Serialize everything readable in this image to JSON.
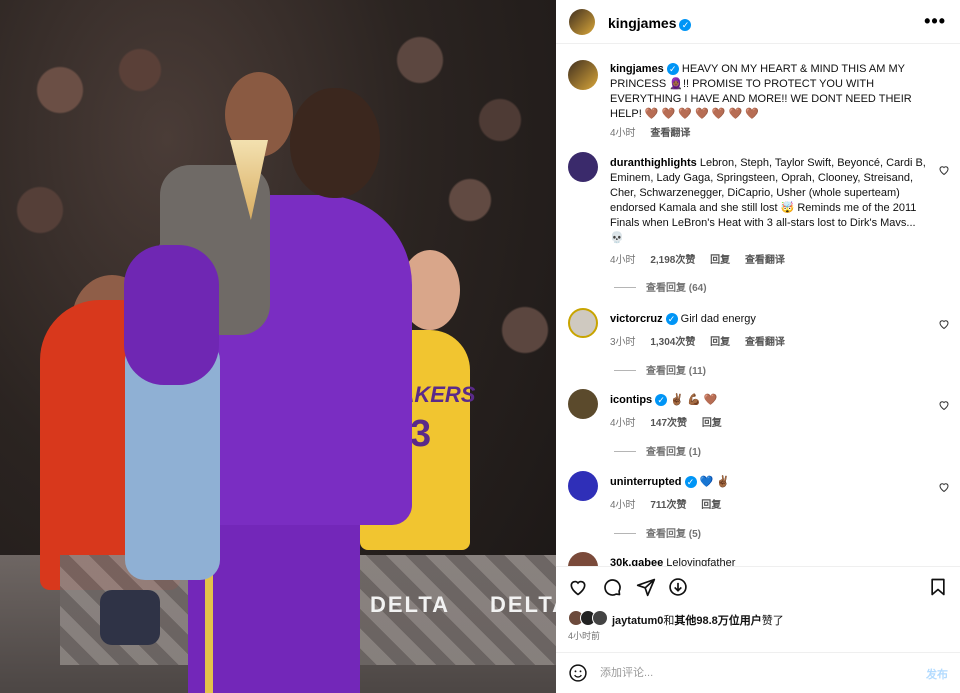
{
  "header": {
    "username": "kingjames",
    "verified_mark": "✓",
    "more": "•••"
  },
  "caption": {
    "username": "kingjames",
    "text": "HEAVY ON MY HEART & MIND THIS AM MY PRINCESS 🧕🏾!! PROMISE TO PROTECT YOU WITH EVERYTHING I HAVE AND MORE!! WE DONT NEED THEIR HELP! 🤎 🤎 🤎 🤎 🤎 🤎 🤎",
    "time": "4小时",
    "translate": "查看翻译"
  },
  "comments": [
    {
      "username": "duranthighlights",
      "text": "Lebron, Steph, Taylor Swift, Beyoncé, Cardi B, Eminem, Lady Gaga, Springsteen, Oprah, Clooney, Streisand, Cher, Schwarzenegger, DiCaprio, Usher (whole superteam) endorsed Kamala and she still lost 🤯 Reminds me of the 2011 Finals when LeBron's Heat with 3 all-stars lost to Dirk's Mavs... 💀",
      "time": "4小时",
      "likes": "2,198次赞",
      "reply": "回复",
      "translate": "查看翻译",
      "view_replies": "查看回复 (64)",
      "avatar_color": "#3a2a6b"
    },
    {
      "username": "victorcruz",
      "text": "Girl dad energy",
      "time": "3小时",
      "likes": "1,304次赞",
      "reply": "回复",
      "translate": "查看翻译",
      "view_replies": "查看回复 (11)",
      "avatar_color": "#cfc9c0"
    },
    {
      "username": "icontips",
      "verified": true,
      "text": "✌🏾 💪🏾 🤎",
      "time": "4小时",
      "likes": "147次赞",
      "reply": "回复",
      "view_replies": "查看回复 (1)",
      "avatar_color": "#5b4a2c"
    },
    {
      "username": "uninterrupted",
      "verified": true,
      "text": "💙 ✌🏾",
      "time": "4小时",
      "likes": "711次赞",
      "reply": "回复",
      "view_replies": "查看回复 (5)",
      "avatar_color": "#2f2fb8"
    },
    {
      "username": "30k.gabee",
      "text": "Lelovingfather",
      "avatar_color": "#7a4a3a"
    }
  ],
  "likes_bar": {
    "liker": "jaytatum0",
    "connector": "和",
    "others": "其他98.8万位用户",
    "suffix": "赞了",
    "time": "4小时前"
  },
  "composer": {
    "placeholder": "添加评论...",
    "post_label": "发布"
  },
  "photo": {
    "jersey_text": "LAKERS",
    "jersey_number": "3",
    "sponsor": "DELTA"
  }
}
